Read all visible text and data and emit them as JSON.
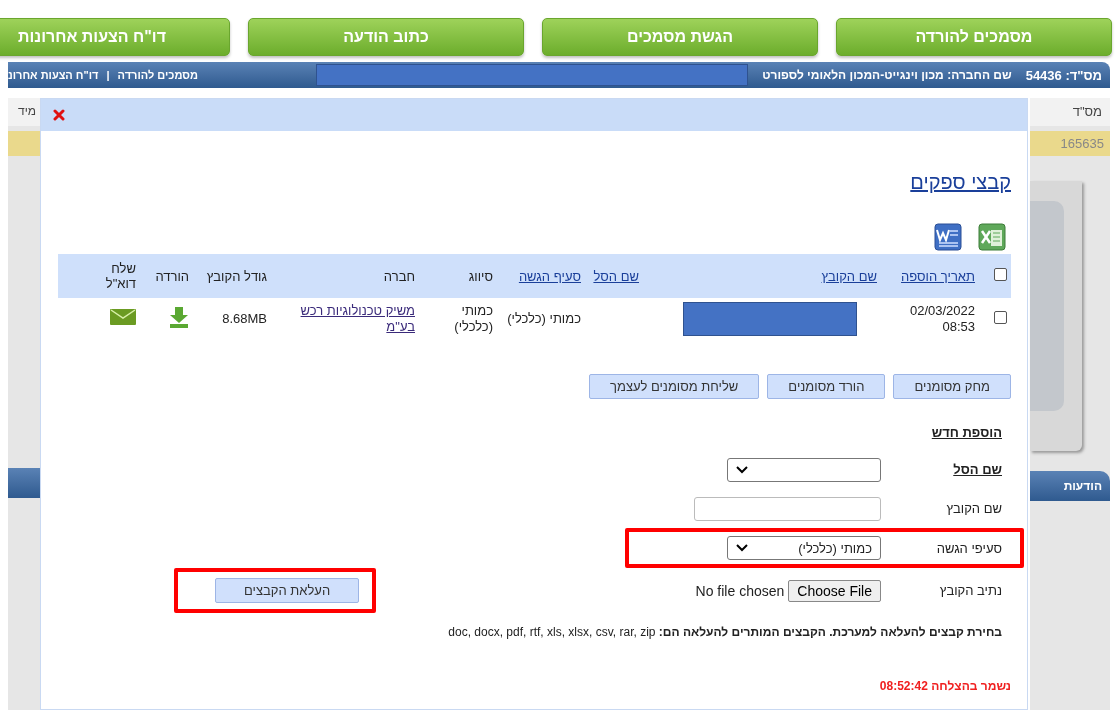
{
  "top_nav": [
    {
      "label": "מסמכים להורדה"
    },
    {
      "label": "הגשת מסמכים"
    },
    {
      "label": "כתוב הודעה"
    },
    {
      "label": "דו\"ח הצעות אחרונות"
    }
  ],
  "info_bar": {
    "supplier_id": "מס\"ד: 54436",
    "company": "שם החברה: מכון וינגייט-המכון הלאומי לספורט",
    "links": [
      "מסמכים להורדה",
      "דו\"ח הצעות אחרונ"
    ],
    "separator": "|"
  },
  "background": {
    "right_column": {
      "header": "מס\"ד",
      "value": "165635",
      "tab": "הודעות"
    },
    "left_column": {
      "header": "מיד"
    }
  },
  "dialog": {
    "title": "קבצי ספקים",
    "table": {
      "select_all_checked": false,
      "columns": [
        {
          "label": "תאריך הוספה",
          "sortable": true
        },
        {
          "label": "שם הקובץ",
          "sortable": true
        },
        {
          "label": "שם הסל",
          "sortable": true
        },
        {
          "label": "סעיף הגשה",
          "sortable": true
        },
        {
          "label": "סיווג",
          "sortable": false
        },
        {
          "label": "חברה",
          "sortable": false
        },
        {
          "label": "גודל הקובץ",
          "sortable": false
        },
        {
          "label": "הורדה",
          "sortable": false
        },
        {
          "label": "שלח דוא\"ל",
          "sortable": false
        }
      ],
      "rows": [
        {
          "checked": false,
          "cells": [
            {
              "kind": "text",
              "text": "02/03/2022 08:53"
            },
            {
              "kind": "redacted"
            },
            {
              "kind": "empty"
            },
            {
              "kind": "text",
              "text": "כמותי (כלכלי)"
            },
            {
              "kind": "text",
              "text": "כמותי (כלכלי)"
            },
            {
              "kind": "link",
              "text": "משיק טכנולוגיות רכש בע\"מ"
            },
            {
              "kind": "text",
              "text": "8.68MB"
            },
            {
              "kind": "download"
            },
            {
              "kind": "mail"
            }
          ]
        }
      ]
    },
    "actions": [
      "מחק מסומנים",
      "הורד מסומנים",
      "שליחת מסומנים לעצמך"
    ],
    "add_new": {
      "heading": "הוספת חדש",
      "fields": [
        {
          "kind": "select",
          "label": "שם הסל",
          "emphasized": true,
          "highlighted": false
        },
        {
          "kind": "input",
          "label": "שם הקובץ",
          "emphasized": false,
          "highlighted": false
        },
        {
          "kind": "select",
          "label": "סעיפי הגשה",
          "value": "כמותי (כלכלי)",
          "emphasized": false,
          "highlighted": true
        },
        {
          "kind": "file",
          "label": "נתיב הקובץ",
          "button": "Choose File",
          "status": "No file chosen",
          "emphasized": false,
          "highlighted": false
        }
      ],
      "upload_button": {
        "label": "העלאת הקבצים",
        "highlighted": true
      },
      "note": "**בחירת קבצים להעלאה למערכת. הקבצים המותרים להעלאה הם:** doc, docx, pdf, rtf, xls, xlsx, csv, rar, zip"
    },
    "saved_message": "נשמר בהצלחה 08:52:42"
  }
}
